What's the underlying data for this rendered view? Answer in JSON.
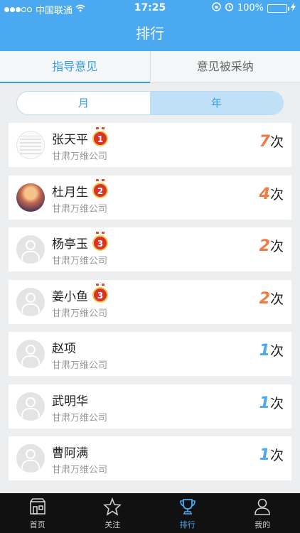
{
  "status": {
    "carrier": "中国联通",
    "time": "17:25",
    "battery": "100%"
  },
  "nav": {
    "title": "排行"
  },
  "tabs": [
    {
      "label": "指导意见",
      "active": true
    },
    {
      "label": "意见被采纳",
      "active": false
    }
  ],
  "segment": [
    {
      "label": "月",
      "active": false
    },
    {
      "label": "年",
      "active": true
    }
  ],
  "times_suffix": "次",
  "ranks": [
    {
      "name": "张天平",
      "company": "甘肃万维公司",
      "count": "7",
      "medal": "1",
      "avatar": "photo-dots"
    },
    {
      "name": "杜月生",
      "company": "甘肃万维公司",
      "count": "4",
      "medal": "2",
      "avatar": "photo-sunset"
    },
    {
      "name": "杨亭玉",
      "company": "甘肃万维公司",
      "count": "2",
      "medal": "3",
      "avatar": "default"
    },
    {
      "name": "姜小鱼",
      "company": "甘肃万维公司",
      "count": "2",
      "medal": "3",
      "avatar": "default"
    },
    {
      "name": "赵项",
      "company": "甘肃万维公司",
      "count": "1",
      "medal": "",
      "avatar": "default"
    },
    {
      "name": "武明华",
      "company": "甘肃万维公司",
      "count": "1",
      "medal": "",
      "avatar": "default"
    },
    {
      "name": "曹阿满",
      "company": "甘肃万维公司",
      "count": "1",
      "medal": "",
      "avatar": "default"
    }
  ],
  "tabbar": [
    {
      "label": "首页",
      "icon": "home-icon",
      "active": false
    },
    {
      "label": "关注",
      "icon": "star-icon",
      "active": false
    },
    {
      "label": "排行",
      "icon": "trophy-icon",
      "active": true
    },
    {
      "label": "我的",
      "icon": "person-icon",
      "active": false
    }
  ],
  "colors": {
    "primary": "#4aa9f0",
    "hot": "#ef7a42",
    "medal": "#d8322a"
  }
}
